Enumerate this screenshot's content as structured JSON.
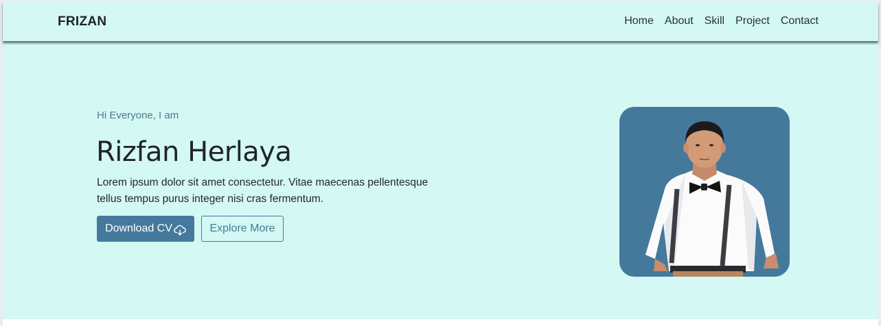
{
  "navbar": {
    "brand": "FRIZAN",
    "links": [
      "Home",
      "About",
      "Skill",
      "Project",
      "Contact"
    ]
  },
  "hero": {
    "greeting": "Hi Everyone, I am",
    "name": "Rizfan Herlaya",
    "description": "Lorem ipsum dolor sit amet consectetur. Vitae maecenas pellentesque tellus tempus purus integer nisi cras fermentum.",
    "primary_button": "Download CV",
    "secondary_button": "Explore More",
    "primary_button_icon": "cloud-download-icon"
  },
  "colors": {
    "background": "#d4f8f3",
    "accent": "#45799c",
    "text": "#202529"
  }
}
